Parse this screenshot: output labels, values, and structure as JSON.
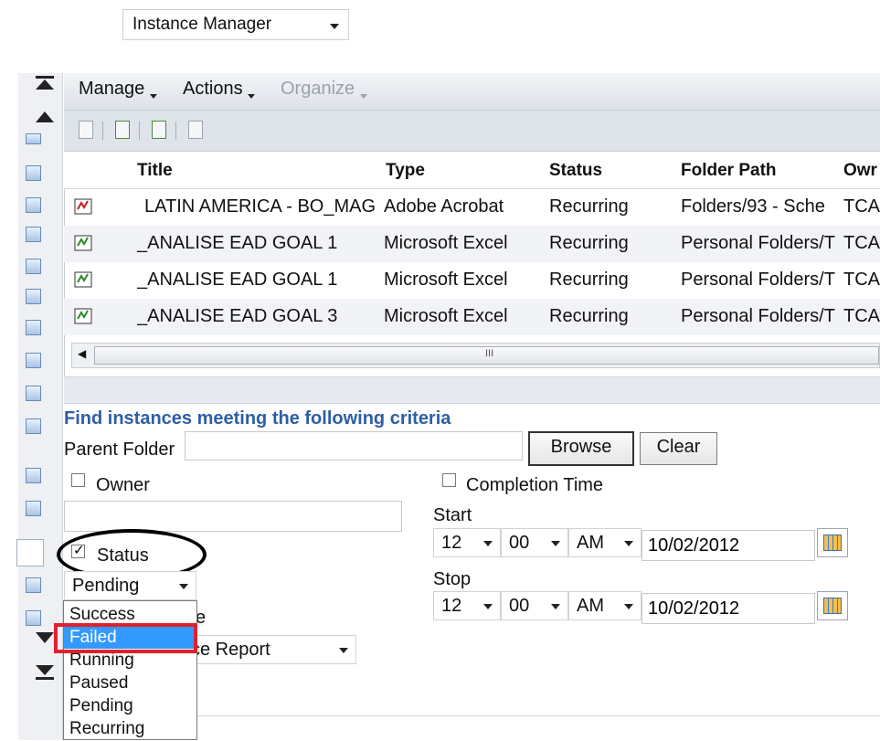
{
  "top_select": {
    "value": "Instance Manager"
  },
  "menubar": {
    "manage": "Manage",
    "actions": "Actions",
    "organize": "Organize"
  },
  "grid": {
    "columns": [
      "Title",
      "Type",
      "Status",
      "Folder Path",
      "Owr"
    ],
    "rows": [
      {
        "title": "LATIN AMERICA - BO_MAG",
        "type": "Adobe Acrobat",
        "status": "Recurring",
        "folder": "Folders/93 - Sche",
        "owner": "TCA"
      },
      {
        "title": "_ANALISE EAD GOAL 1",
        "type": "Microsoft Excel",
        "status": "Recurring",
        "folder": "Personal Folders/T",
        "owner": "TCA"
      },
      {
        "title": "_ANALISE EAD GOAL 1",
        "type": "Microsoft Excel",
        "status": "Recurring",
        "folder": "Personal Folders/T",
        "owner": "TCA"
      },
      {
        "title": "_ANALISE EAD GOAL 3",
        "type": "Microsoft Excel",
        "status": "Recurring",
        "folder": "Personal Folders/T",
        "owner": "TCA"
      }
    ],
    "scroll_grip": "III"
  },
  "criteria": {
    "title": "Find instances meeting the following criteria",
    "parent_folder_label": "Parent Folder",
    "parent_folder_value": "",
    "browse": "Browse",
    "clear": "Clear",
    "owner_label": "Owner",
    "owner_value": "",
    "completion_label": "Completion Time",
    "start_label": "Start",
    "stop_label": "Stop",
    "start": {
      "hour": "12",
      "minute": "00",
      "ampm": "AM",
      "date": "10/02/2012"
    },
    "stop": {
      "hour": "12",
      "minute": "00",
      "ampm": "AM",
      "date": "10/02/2012"
    },
    "status_label": "Status",
    "status_value": "Pending",
    "type_select_value": "ce Report",
    "hidden_label_fragment": "e"
  },
  "status_options": [
    "Success",
    "Failed",
    "Running",
    "Paused",
    "Pending",
    "Recurring"
  ],
  "status_highlighted": "Failed",
  "colors": {
    "accent_blue": "#2e5ea6",
    "highlight": "#3399ff",
    "annotation_red": "#e0202e"
  }
}
